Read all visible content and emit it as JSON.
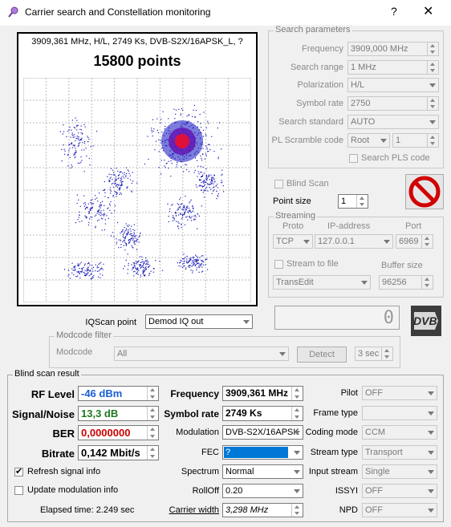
{
  "window": {
    "title": "Carrier search and Constellation monitoring",
    "help": "?",
    "close": "✕"
  },
  "plot": {
    "info": "3909,361 MHz, H/L, 2749 Ks, DVB-S2X/16APSK_L, ?",
    "points": "15800 points"
  },
  "search": {
    "group": "Search parameters",
    "frequency_label": "Frequency",
    "frequency_value": "3909,000 MHz",
    "range_label": "Search range",
    "range_value": "1 MHz",
    "polarization_label": "Polarization",
    "polarization_value": "H/L",
    "symbolrate_label": "Symbol rate",
    "symbolrate_value": "2750",
    "standard_label": "Search standard",
    "standard_value": "AUTO",
    "pl_label": "PL Scramble code",
    "pl_mode": "Root",
    "pl_value": "1",
    "searchpls_label": "Search PLS code"
  },
  "blind": {
    "label": "Blind Scan",
    "pointsize_label": "Point size",
    "pointsize_value": "1"
  },
  "streaming": {
    "group": "Streaming",
    "proto_label": "Proto",
    "ip_label": "IP-address",
    "port_label": "Port",
    "proto": "TCP",
    "ip": "127.0.0.1",
    "port": "6969",
    "tofile_label": "Stream to file",
    "buffer_label": "Buffer size",
    "target": "TransEdit",
    "buffer": "96256"
  },
  "counter": "0",
  "dvb": "DVB",
  "iqscan": {
    "label": "IQScan point",
    "value": "Demod IQ out"
  },
  "modcode": {
    "group": "Modcode filter",
    "label": "Modcode",
    "value": "All",
    "detect": "Detect",
    "sec": "3 sec"
  },
  "result": {
    "group": "Blind scan result",
    "rflevel_label": "RF Level",
    "rflevel": "-46 dBm",
    "sn_label": "Signal/Noise",
    "sn": "13,3 dB",
    "ber_label": "BER",
    "ber": "0,0000000",
    "bitrate_label": "Bitrate",
    "bitrate": "0,142 Mbit/s",
    "refresh_label": "Refresh signal info",
    "update_label": "Update modulation info",
    "elapsed": "Elapsed time: 2.249 sec",
    "frequency_label": "Frequency",
    "frequency": "3909,361 MHz",
    "symbolrate_label": "Symbol rate",
    "symbolrate": "2749 Ks",
    "modulation_label": "Modulation",
    "modulation": "DVB-S2X/16APSK",
    "fec_label": "FEC",
    "fec": "?",
    "spectrum_label": "Spectrum",
    "spectrum": "Normal",
    "rolloff_label": "RollOff",
    "rolloff": "0.20",
    "carrierwidth_label": "Carrier width",
    "carrierwidth": "3,298 MHz",
    "pilot_label": "Pilot",
    "pilot": "OFF",
    "frametype_label": "Frame type",
    "frametype": "",
    "codingmode_label": "Coding mode",
    "codingmode": "CCM",
    "streamtype_label": "Stream type",
    "streamtype": "Transport",
    "inputstream_label": "Input stream",
    "inputstream": "Single",
    "issyi_label": "ISSYI",
    "issyi": "OFF",
    "npd_label": "NPD",
    "npd": "OFF"
  },
  "colors": {
    "rflevel": "#1a5fd6",
    "sn": "#1f7a1f",
    "ber": "#cc0000",
    "fec_highlight": "#0078d7"
  }
}
